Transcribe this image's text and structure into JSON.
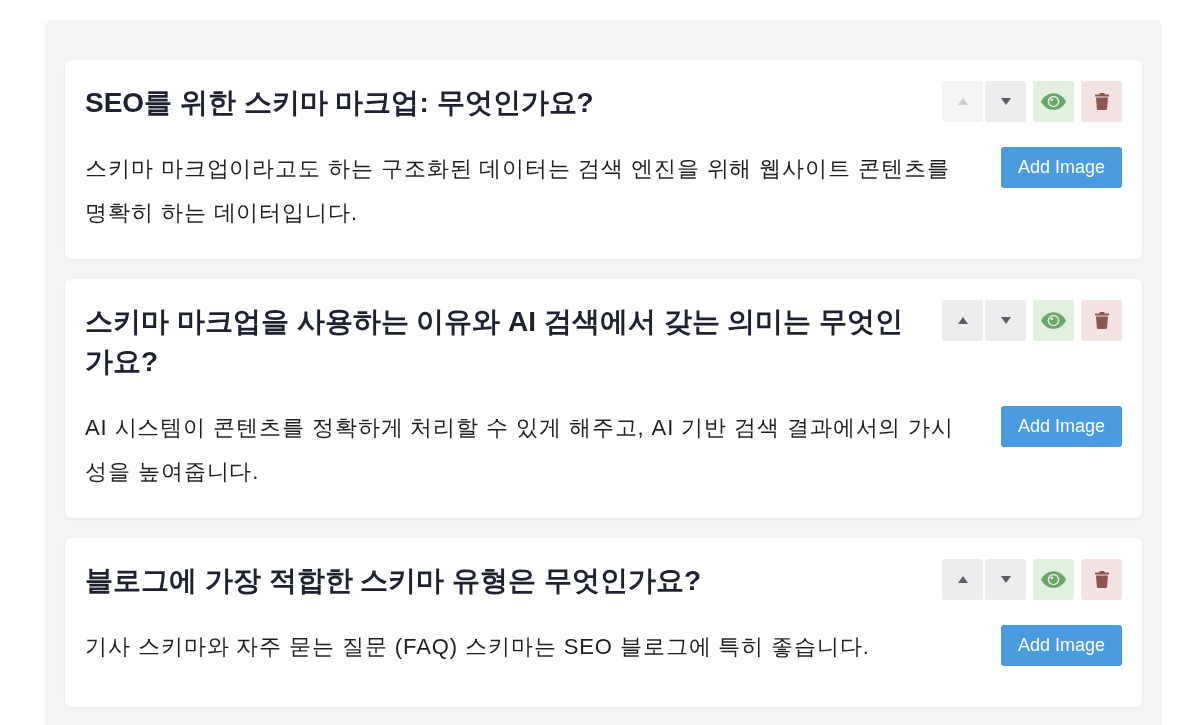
{
  "faq_items": [
    {
      "title": "SEO를 위한 스키마 마크업: 무엇인가요?",
      "answer": "스키마 마크업이라고도 하는 구조화된 데이터는 검색 엔진을 위해 웹사이트 콘텐츠를 명확히 하는 데이터입니다.",
      "move_up": {
        "disabled": true
      },
      "move_down": {
        "disabled": false
      },
      "add_image_button": "Add Image"
    },
    {
      "title": "스키마 마크업을 사용하는 이유와 AI 검색에서 갖는 의미는 무엇인가요?",
      "answer": "AI 시스템이 콘텐츠를 정확하게 처리할 수 있게 해주고, AI 기반 검색 결과에서의 가시성을 높여줍니다.",
      "move_up": {
        "disabled": false
      },
      "move_down": {
        "disabled": false
      },
      "add_image_button": "Add Image"
    },
    {
      "title": "블로그에 가장 적합한 스키마 유형은 무엇인가요?",
      "answer": "기사 스키마와 자주 묻는 질문 (FAQ) 스키마는 SEO 블로그에 특히 좋습니다.",
      "move_up": {
        "disabled": false
      },
      "move_down": {
        "disabled": false
      },
      "add_image_button": "Add Image"
    }
  ]
}
